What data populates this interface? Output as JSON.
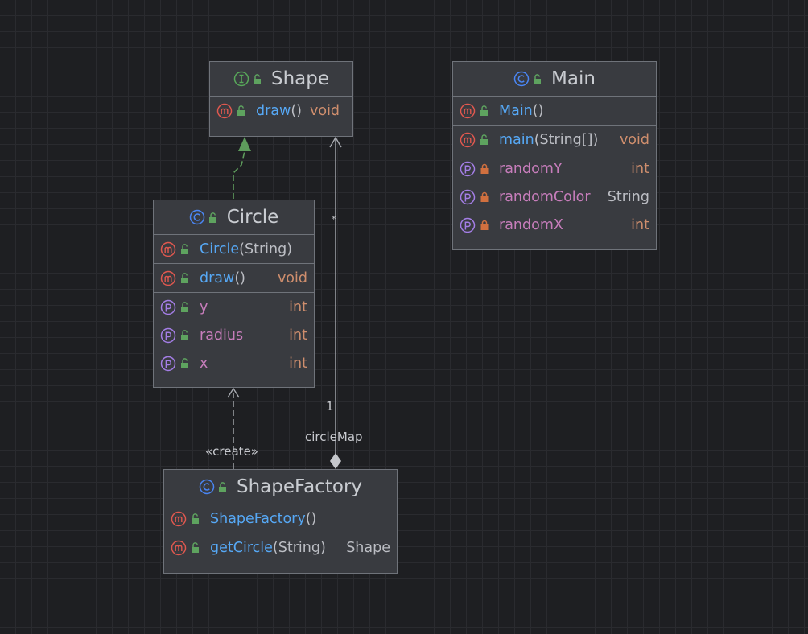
{
  "diagram": {
    "classes": {
      "shape": {
        "name": "Shape",
        "kind_icon": "interface-icon",
        "methods": [
          {
            "name": "draw",
            "params": "()",
            "type": "void"
          }
        ]
      },
      "main": {
        "name": "Main",
        "kind_icon": "class-icon",
        "constructors": [
          {
            "name": "Main",
            "params": "()"
          }
        ],
        "methods": [
          {
            "name": "main",
            "params": "(String[])",
            "type": "void"
          }
        ],
        "fields": [
          {
            "name": "randomY",
            "type": "int",
            "visibility": "private"
          },
          {
            "name": "randomColor",
            "type": "String",
            "visibility": "private"
          },
          {
            "name": "randomX",
            "type": "int",
            "visibility": "private"
          }
        ]
      },
      "circle": {
        "name": "Circle",
        "kind_icon": "class-icon",
        "constructors": [
          {
            "name": "Circle",
            "params": "(String)"
          }
        ],
        "methods": [
          {
            "name": "draw",
            "params": "()",
            "type": "void"
          }
        ],
        "fields": [
          {
            "name": "y",
            "type": "int",
            "visibility": "package"
          },
          {
            "name": "radius",
            "type": "int",
            "visibility": "package"
          },
          {
            "name": "x",
            "type": "int",
            "visibility": "package"
          }
        ]
      },
      "shape_factory": {
        "name": "ShapeFactory",
        "kind_icon": "class-icon",
        "constructors": [
          {
            "name": "ShapeFactory",
            "params": "()"
          }
        ],
        "methods": [
          {
            "name": "getCircle",
            "params": "(String)",
            "type": "Shape"
          }
        ]
      }
    },
    "relations": {
      "implements": {
        "from": "Circle",
        "to": "Shape"
      },
      "create": {
        "from": "ShapeFactory",
        "to": "Circle",
        "label": "«create»"
      },
      "composition": {
        "from": "ShapeFactory",
        "to": "Shape",
        "label": "circleMap",
        "multiplicity_source": "1",
        "multiplicity_target": "*"
      }
    }
  },
  "colors": {
    "background": "#1e1f22",
    "node_fill": "#393b40",
    "method_name": "#56a8f5",
    "field_name": "#c77dbb",
    "return_type": "#cf8e6d",
    "method_badge": "#e0584f",
    "field_badge": "#a47ee6",
    "class_badge": "#4a86f5",
    "interface_badge": "#58a85a",
    "public_lock": "#5ea35f",
    "private_lock": "#d1703f"
  }
}
